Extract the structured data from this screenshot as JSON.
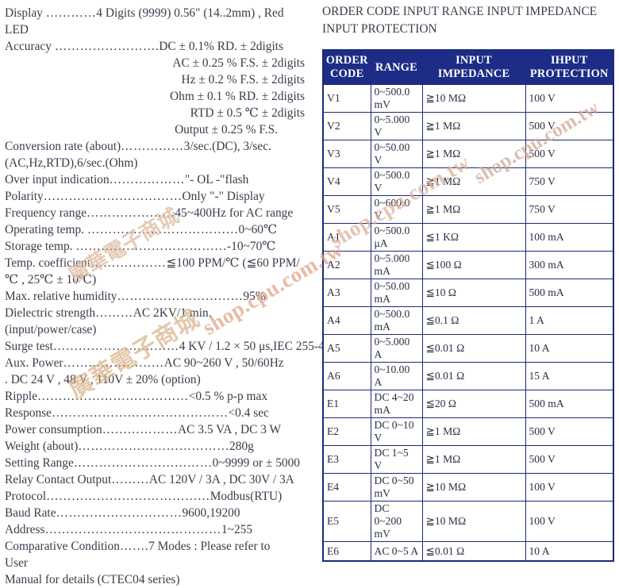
{
  "specs": [
    {
      "label": "Display ",
      "dots": "…………",
      "value": "4 Digits (9999) 0.56\" (14..2mm) , Red",
      "align": "left"
    },
    {
      "label": "LED",
      "dots": "",
      "value": "",
      "align": "left"
    },
    {
      "label": "Accuracy ",
      "dots": "…………………….",
      "value": "DC ± 0.1% RD. ± 2digits",
      "align": "left"
    },
    {
      "label": "",
      "dots": "",
      "value": "AC ± 0.25 % F.S. ± 2digits",
      "align": "right"
    },
    {
      "label": "",
      "dots": "",
      "value": "Hz ± 0.2 % F.S. ± 2digits",
      "align": "right"
    },
    {
      "label": "",
      "dots": "",
      "value": "Ohm ± 0.1 % RD. ± 2digits",
      "align": "right"
    },
    {
      "label": "",
      "dots": "",
      "value": "RTD ± 0.5 ℃ ± 2digits",
      "align": "right"
    },
    {
      "label": "",
      "dots": "",
      "value": "Output ± 0.25 % F.S.",
      "align": "right-out"
    },
    {
      "label": "Conversion rate (about)",
      "dots": "……………",
      "value": "3/sec.(DC), 3/sec.",
      "align": "left"
    },
    {
      "label": "(AC,Hz,RTD),6/sec.(Ohm)",
      "dots": "",
      "value": "",
      "align": "left"
    },
    {
      "label": "Over input indication",
      "dots": "………………",
      "value": "\"- OL -\"flash",
      "align": "left"
    },
    {
      "label": "Polarity",
      "dots": "……………………………",
      "value": "Only \"-\" Display",
      "align": "left"
    },
    {
      "label": "Frequency range",
      "dots": "…………………",
      "value": "45~400Hz for AC range",
      "align": "left"
    },
    {
      "label": "Operating temp. ",
      "dots": "………………………………",
      "value": "0~60℃",
      "align": "left"
    },
    {
      "label": "Storage temp. ",
      "dots": "………………………………",
      "value": "-10~70℃",
      "align": "left"
    },
    {
      "label": "Temp. coefficient",
      "dots": "………………",
      "value": "≦100 PPM/℃ (≦60 PPM/",
      "align": "left"
    },
    {
      "label": "℃ , 25℃ ± 10℃)",
      "dots": "",
      "value": "",
      "align": "left"
    },
    {
      "label": "Max. relative humidity",
      "dots": "…………………………",
      "value": "95%",
      "align": "left"
    },
    {
      "label": "Dielectric strength",
      "dots": "………",
      "value": "AC 2KV/1 min.",
      "align": "left"
    },
    {
      "label": "(input/power/case)",
      "dots": "",
      "value": "",
      "align": "left"
    },
    {
      "label": "Surge test",
      "dots": "…………………………",
      "value": "4 KV / 1.2 × 50 μs,IEC 255-4",
      "align": "left"
    },
    {
      "label": "Aux. Power",
      "dots": "……………………",
      "value": "AC 90~260 V , 50/60Hz",
      "align": "left"
    },
    {
      "label": ". DC 24 V , 48 V , 110V ± 20% (option)",
      "dots": "",
      "value": "",
      "align": "left"
    },
    {
      "label": "Ripple",
      "dots": "………………………………",
      "value": "<0.5 % p-p max",
      "align": "left"
    },
    {
      "label": "Response",
      "dots": "……………………………………",
      "value": "<0.4 sec",
      "align": "left"
    },
    {
      "label": "Power consumption",
      "dots": "………………",
      "value": "AC 3.5 VA , DC 3 W",
      "align": "left"
    },
    {
      "label": "Weight (about)",
      "dots": "………………………………",
      "value": "280g",
      "align": "left"
    },
    {
      "label": "Setting Range",
      "dots": "……………………………",
      "value": "0~9999 or ± 5000",
      "align": "left"
    },
    {
      "label": "Relay Contact Output",
      "dots": "………",
      "value": "AC 120V / 3A , DC 30V / 3A",
      "align": "left"
    },
    {
      "label": "Protocol",
      "dots": "…………………………………",
      "value": "Modbus(RTU)",
      "align": "left"
    },
    {
      "label": "Baud Rate",
      "dots": "…………………………",
      "value": "9600,19200",
      "align": "left"
    },
    {
      "label": "Address",
      "dots": "……………………………………",
      "value": "1~255",
      "align": "left"
    },
    {
      "label": "Comparative Condition",
      "dots": "…….",
      "value": "7 Modes : Please refer to",
      "align": "left"
    },
    {
      "label": "User",
      "dots": "",
      "value": "",
      "align": "left"
    },
    {
      "label": "Manual for details (CTEC04 series)",
      "dots": "",
      "value": "",
      "align": "left"
    }
  ],
  "table": {
    "heading": "ORDER CODE INPUT RANGE INPUT IMPEDANCE INPUT PROTECTION",
    "columns": [
      "ORDER CODE",
      "RANGE",
      "INPUT IMPEDANCE",
      "IHPUT PROTECTION"
    ],
    "rows": [
      {
        "code": "V1",
        "range": "0~500.0 mV",
        "impedance": "≧10 MΩ",
        "protection": "100 V"
      },
      {
        "code": "V2",
        "range": "0~5.000 V",
        "impedance": "≧1 MΩ",
        "protection": "500 V"
      },
      {
        "code": "V3",
        "range": "0~50.00 V",
        "impedance": "≧1 MΩ",
        "protection": "500 V"
      },
      {
        "code": "V4",
        "range": "0~500.0 V",
        "impedance": "≧1 MΩ",
        "protection": "750 V"
      },
      {
        "code": "V5",
        "range": "0~600.0 V",
        "impedance": "≧1 MΩ",
        "protection": "750 V"
      },
      {
        "code": "A1",
        "range": "0~500.0 μA",
        "impedance": "≦1 KΩ",
        "protection": "100 mA"
      },
      {
        "code": "A2",
        "range": "0~5.000 mA",
        "impedance": "≦100 Ω",
        "protection": "300 mA"
      },
      {
        "code": "A3",
        "range": "0~50.00 mA",
        "impedance": "≦10 Ω",
        "protection": "500 mA"
      },
      {
        "code": "A4",
        "range": "0~500.0 mA",
        "impedance": "≦0.1 Ω",
        "protection": "1 A"
      },
      {
        "code": "A5",
        "range": "0~5.000 A",
        "impedance": "≦0.01 Ω",
        "protection": "10 A"
      },
      {
        "code": "A6",
        "range": "0~10.00 A",
        "impedance": "≦0.01 Ω",
        "protection": "15 A"
      },
      {
        "code": "E1",
        "range": "DC 4~20 mA",
        "impedance": "≦20 Ω",
        "protection": "500 mA"
      },
      {
        "code": "E2",
        "range": "DC 0~10 V",
        "impedance": "≧1 MΩ",
        "protection": "500 V"
      },
      {
        "code": "E3",
        "range": "DC 1~5 V",
        "impedance": "≧1 MΩ",
        "protection": "500 V"
      },
      {
        "code": "E4",
        "range": "DC 0~50 mV",
        "impedance": "≧10 MΩ",
        "protection": "100 V"
      },
      {
        "code": "E5",
        "range": "DC 0~200 mV",
        "impedance": "≧10 MΩ",
        "protection": "100 V"
      },
      {
        "code": "E6",
        "range": "AC 0~5 A",
        "impedance": "≦0.01 Ω",
        "protection": "10 A"
      }
    ]
  },
  "watermark": {
    "chinese": "廣華電子商城",
    "url": "shop.cpu.com.tw"
  },
  "colors": {
    "table_header_bg": "#1d2c86",
    "table_border": "#1b2a7a",
    "body_text": "#3c3c4c",
    "watermark_warm": "#d9b48a",
    "watermark_salmon": "#e0a083"
  }
}
